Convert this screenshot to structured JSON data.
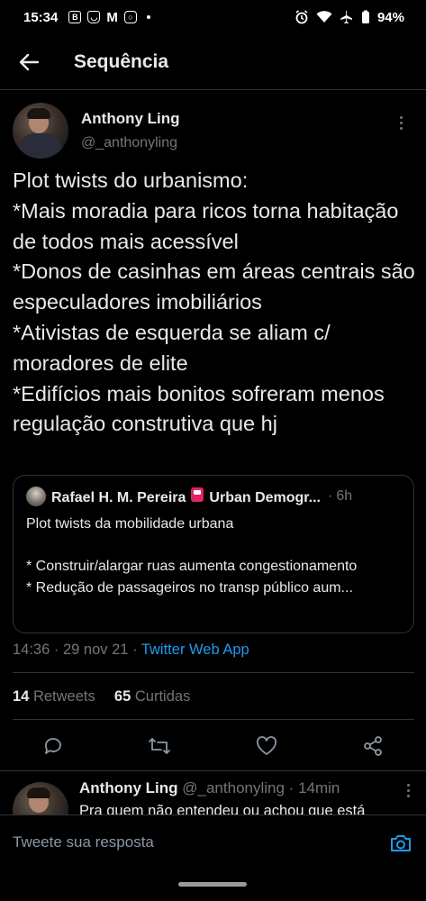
{
  "status_bar": {
    "time": "15:34",
    "battery": "94%",
    "app_icons": [
      "b-icon",
      "bag-icon",
      "gmail-icon",
      "instagram-icon"
    ],
    "system_icons": [
      "alarm-icon",
      "wifi-icon",
      "airplane-icon",
      "battery-icon"
    ]
  },
  "header": {
    "title": "Sequência"
  },
  "tweet": {
    "author_name": "Anthony Ling",
    "author_handle": "@_anthonyling",
    "text": "Plot twists do urbanismo:\n*Mais moradia para ricos torna habitação de todos mais acessível\n*Donos de casinhas em áreas centrais são especuladores imobiliários\n*Ativistas de esquerda se aliam c/ moradores de elite\n*Edifícios mais bonitos sofreram menos regulação construtiva que hj",
    "quoted": {
      "author_name": "Rafael H. M. Pereira",
      "author_suffix": "Urban Demogr...",
      "time": "6h",
      "text": "Plot twists da mobilidade urbana\n\n* Construir/alargar ruas aumenta congestionamento",
      "last_line": "* Redução de passageiros no transp público aum..."
    },
    "time": "14:36",
    "date": "29 nov 21",
    "source": "Twitter Web App",
    "retweets_count": "14",
    "retweets_label": "Retweets",
    "likes_count": "65",
    "likes_label": "Curtidas"
  },
  "reply": {
    "author_name": "Anthony Ling",
    "author_handle": "@_anthonyling",
    "time": "14min",
    "text": "Pra quem não entendeu ou achou que está"
  },
  "composer": {
    "placeholder": "Tweete sua resposta"
  },
  "colors": {
    "background": "#000000",
    "text": "#e7e9ea",
    "secondary": "#71767b",
    "accent": "#1d9bf0",
    "divider": "#2f3336"
  }
}
